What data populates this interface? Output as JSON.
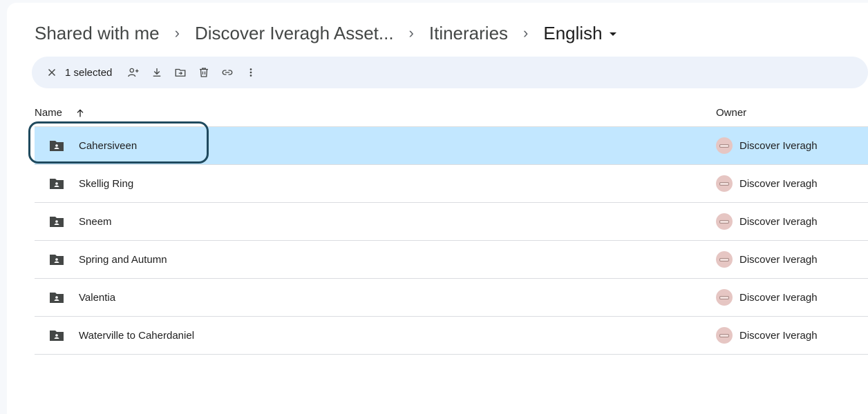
{
  "breadcrumb": {
    "items": [
      "Shared with me",
      "Discover Iveragh Asset...",
      "Itineraries"
    ],
    "current": "English",
    "separator": "›"
  },
  "toolbar": {
    "close_icon": "close-icon",
    "selected_label": "1 selected",
    "actions": [
      "share-icon",
      "download-icon",
      "move-icon",
      "trash-icon",
      "link-icon",
      "more-vert-icon"
    ]
  },
  "table": {
    "columns": {
      "name": "Name",
      "owner": "Owner"
    },
    "sort": "ascending",
    "rows": [
      {
        "name": "Cahersiveen",
        "owner": "Discover Iveragh",
        "selected": true
      },
      {
        "name": "Skellig Ring",
        "owner": "Discover Iveragh",
        "selected": false
      },
      {
        "name": "Sneem",
        "owner": "Discover Iveragh",
        "selected": false
      },
      {
        "name": "Spring and Autumn",
        "owner": "Discover Iveragh",
        "selected": false
      },
      {
        "name": "Valentia",
        "owner": "Discover Iveragh",
        "selected": false
      },
      {
        "name": "Waterville to Caherdaniel",
        "owner": "Discover Iveragh",
        "selected": false
      }
    ]
  },
  "colors": {
    "selected_row": "#c2e7ff",
    "toolbar_bg": "#edf2fa",
    "focus_ring": "#1f4a5e"
  }
}
